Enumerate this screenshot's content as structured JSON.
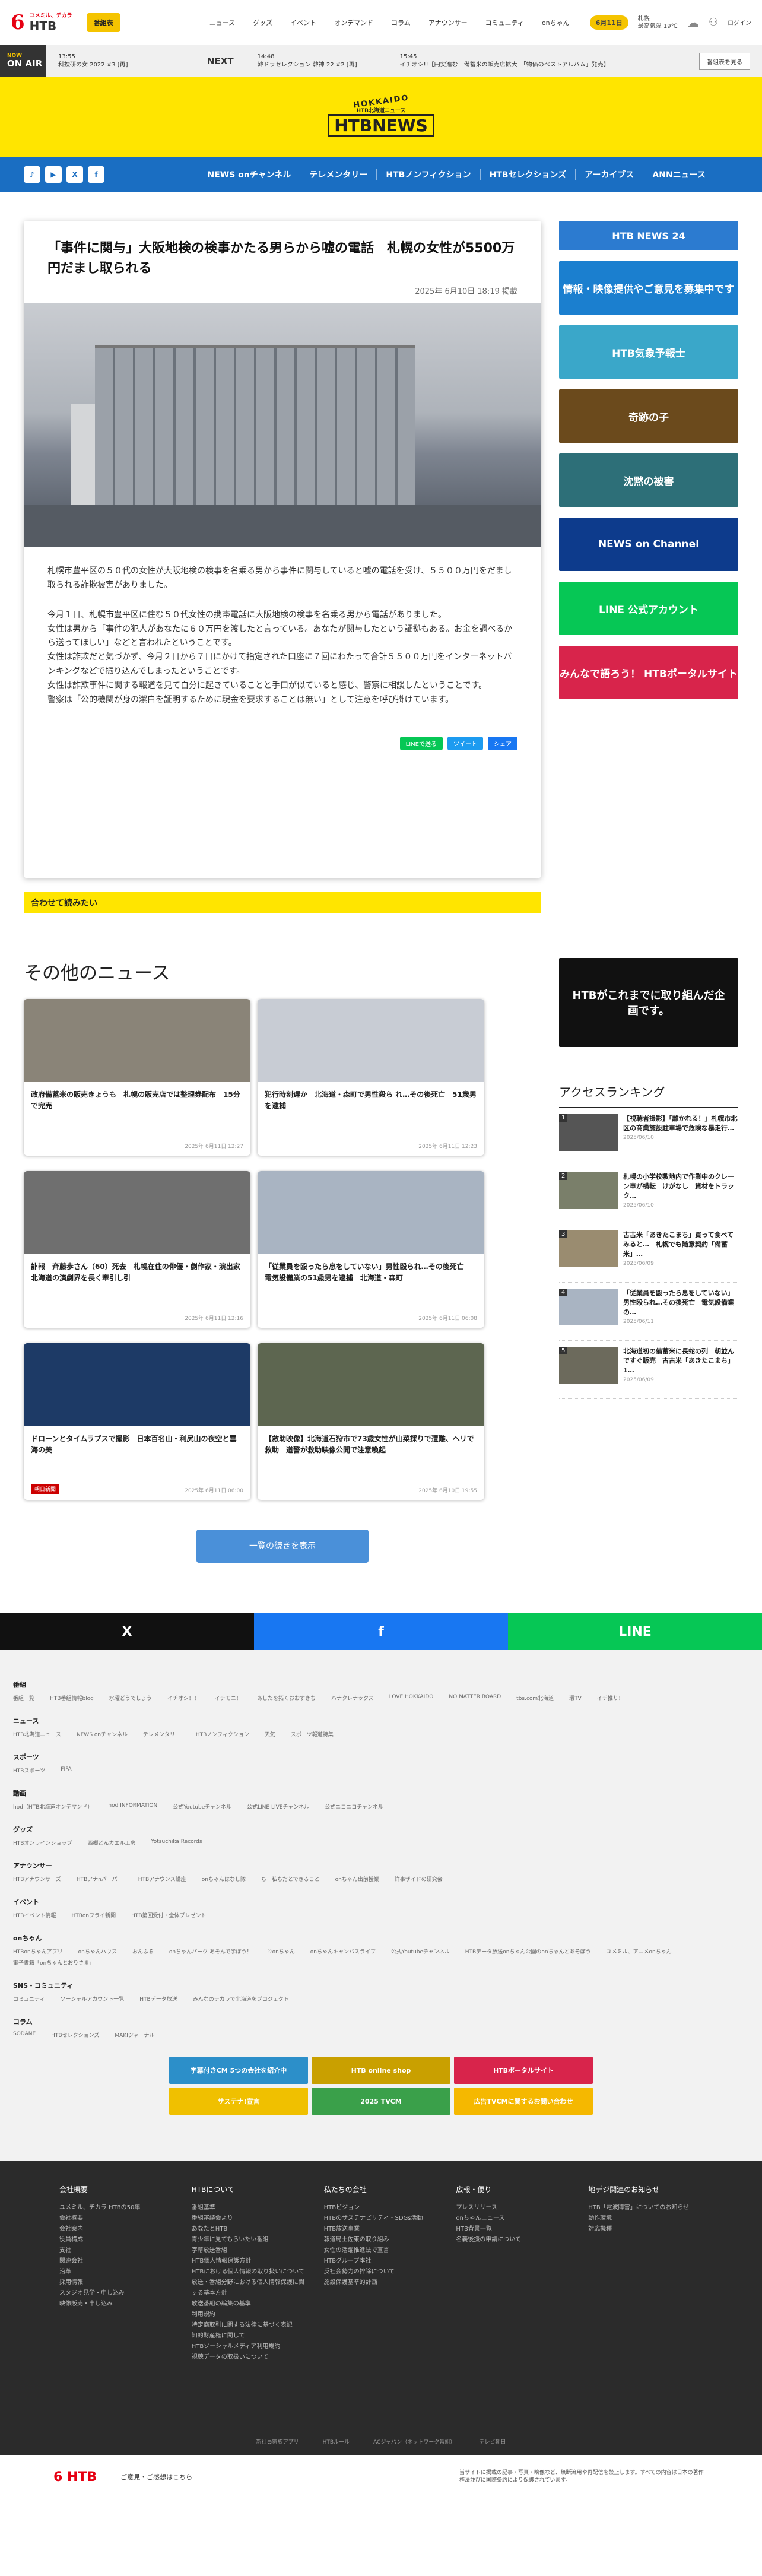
{
  "header": {
    "logo_main": "6",
    "logo_sub": "HTB",
    "logo_tag": "ユメミル、チカラ",
    "bangumi_button": "番組表",
    "nav": [
      "ニュース",
      "グッズ",
      "イベント",
      "オンデマンド",
      "コラム",
      "アナウンサー",
      "コミュニティ",
      "onちゃん"
    ],
    "date": "6月11日",
    "weather": "札幌",
    "weather_temp": "最高気温 19℃",
    "login": "ログイン"
  },
  "onair": {
    "tag_main": "ON AIR",
    "tag_sub": "NOW",
    "now_time": "13:55",
    "now_title": "科捜研の女 2022 #3 [再]",
    "next_label": "NEXT",
    "next_time": "14:48",
    "next_title": "韓ドラセレクション 韓神 22 #2 [再]",
    "ticker_time": "15:45",
    "ticker": "イチオシ!!【円安進む　備蓄米の販売店拡大　「物価のベストアルバム」発売】",
    "button": "番組表を見る"
  },
  "brand": {
    "hokkaido": "HOKKAIDO",
    "name": "HTBNEWS",
    "sub": "HTB北海道ニュース"
  },
  "nav": {
    "social": [
      "TikTok",
      "YouTube",
      "X",
      "Facebook"
    ],
    "links": [
      "NEWS onチャンネル",
      "テレメンタリー",
      "HTBノンフィクション",
      "HTBセレクションズ",
      "アーカイブス",
      "ANNニュース"
    ]
  },
  "article": {
    "title": "「事件に関与」大阪地検の検事かたる男らから嘘の電話　札幌の女性が5500万円だまし取られる",
    "date": "2025年 6月10日 18:19 掲載",
    "lead": "札幌市豊平区の５０代の女性が大阪地検の検事を名乗る男から事件に関与していると嘘の電話を受け、５５００万円をだまし取られる詐欺被害がありました。",
    "paragraphs": [
      "今月１日、札幌市豊平区に住む５０代女性の携帯電話に大阪地検の検事を名乗る男から電話がありました。",
      "女性は男から「事件の犯人があなたに６０万円を渡したと言っている。あなたが関与したという証拠もある。お金を調べるから送ってほしい」などと言われたということです。",
      "女性は詐欺だと気づかず、今月２日から７日にかけて指定された口座に７回にわたって合計５５００万円をインターネットバンキングなどで振り込んでしまったということです。",
      "女性は詐欺事件に関する報道を見て自分に起きていることと手口が似ていると感じ、警察に相談したということです。",
      "警察は「公的機関が身の潔白を証明するために現金を要求することは無い」として注意を呼び掛けています。"
    ],
    "share_line": "LINEで送る",
    "share_x": "ツイート",
    "share_fb": "シェア",
    "cta": "合わせて読みたい"
  },
  "sidebar": {
    "banners": [
      {
        "text": "HTB NEWS 24",
        "color": "#2c7bd0"
      },
      {
        "text": "情報・映像提供やご意見を募集中です",
        "color": "#1b7fcf"
      },
      {
        "text": "HTB気象予報士",
        "color": "#3aa7c9"
      },
      {
        "text": "奇跡の子",
        "color": "#6b4a1c"
      },
      {
        "text": "沈黙の被害",
        "color": "#2d6f78"
      },
      {
        "text": "NEWS on Channel",
        "color": "#0d3b8c"
      },
      {
        "text": "LINE 公式アカウント",
        "color": "#06c755"
      },
      {
        "text": "みんなで語ろう！ HTBポータルサイト",
        "color": "#d8244b"
      }
    ],
    "promo": "HTBがこれまでに取り組んだ企画です。"
  },
  "other": {
    "heading": "その他のニュース",
    "cards": [
      {
        "title": "政府備蓄米の販売きょうも　札幌の販売店では整理券配布　15分で完売",
        "date": "2025年 6月11日 12:27",
        "tag": "",
        "color": "#8a8478"
      },
      {
        "title": "犯行時刻遅か　北海道・森町で男性殺ら れ…その後死亡　51歳男を逮捕",
        "date": "2025年 6月11日 12:23",
        "tag": "",
        "color": "#c8ccd4"
      },
      {
        "title": "訃報　斉藤歩さん（60）死去　札幌在住の俳優・劇作家・演出家　北海道の演劇界を長く牽引し引",
        "date": "2025年 6月11日 12:16",
        "tag": "",
        "color": "#6f6f6f"
      },
      {
        "title": "「従業員を殴ったら息をしていない」男性殴られ…その後死亡　電気設備業の51歳男を逮捕　北海道・森町",
        "date": "2025年 6月11日 06:08",
        "tag": "",
        "color": "#a9b4c2"
      },
      {
        "title": "ドローンとタイムラプスで撮影　日本百名山・利尻山の夜空と雲海の美",
        "date": "2025年 6月11日 06:00",
        "tag": "朝日新聞",
        "color": "#1d3a66"
      },
      {
        "title": "【救助映像】北海道石狩市で73歳女性が山菜採りで遭難、ヘリで救助　道警が救助映像公開で注意喚起",
        "date": "2025年 6月10日 19:55",
        "tag": "",
        "color": "#5d6650"
      }
    ],
    "more_button": "一覧の続きを表示",
    "ranking_title": "アクセスランキング",
    "ranking": [
      {
        "title": "【視聴者撮影】「離かれる！」札幌市北区の商業施設駐車場で危険な暴走行…",
        "date": "2025/06/10",
        "color": "#555"
      },
      {
        "title": "札幌の小学校敷地内で作業中のクレーン車が横転　けがなし　資材をトラック…",
        "date": "2025/06/10",
        "color": "#7a7f6a"
      },
      {
        "title": "古古米「あきたこまち」買って食べてみると…　札幌でも随意契約「備蓄米」…",
        "date": "2025/06/09",
        "color": "#9a8c70"
      },
      {
        "title": "「従業員を殴ったら息をしていない」男性殴られ…その後死亡　電気設備業の…",
        "date": "2025/06/11",
        "color": "#a9b4c2"
      },
      {
        "title": "北海道初の備蓄米に長蛇の列　朝並んですぐ販売　古古米「あきたこまち」1…",
        "date": "2025/06/09",
        "color": "#6c6a5c"
      }
    ]
  },
  "share_row": {
    "x": "X",
    "facebook": "f",
    "line": "LINE"
  },
  "footer_links": [
    {
      "title": "番組",
      "items": [
        "番組一覧",
        "HTB番組情報blog",
        "水曜どうでしょう",
        "イチオシ！！",
        "イチモニ！",
        "あしたを拓くおおすきち",
        "ハナタレナックス",
        "LOVE HOKKAIDO",
        "NO MATTER BOARD",
        "tbs.com北海道",
        "環TV",
        "イチ推り！"
      ]
    },
    {
      "title": "ニュース",
      "items": [
        "HTB北海道ニュース",
        "NEWS onチャンネル",
        "テレメンタリー",
        "HTBノンフィクション",
        "天気",
        "スポーツ報道特集"
      ]
    },
    {
      "title": "スポーツ",
      "items": [
        "HTBスポーツ",
        "FIFA"
      ]
    },
    {
      "title": "動画",
      "items": [
        "hod（HTB北海道オンデマンド）",
        "hod INFORMATION",
        "公式Youtubeチャンネル",
        "公式LINE LIVEチャンネル",
        "公式ニコニコチャンネル"
      ]
    },
    {
      "title": "グッズ",
      "items": [
        "HTBオンラインショップ",
        "西郷どんカエル工房",
        "Yotsuchika Records"
      ]
    },
    {
      "title": "アナウンサー",
      "items": [
        "HTBアナウンサーズ",
        "HTBアナnパーパー",
        "HTBアナウンス講座",
        "onちゃんはなし隊",
        "ち　私ちだとできること",
        "onちゃん出前授業",
        "詳事ザイドの研究会"
      ]
    },
    {
      "title": "イベント",
      "items": [
        "HTBイベント情報",
        "HTBonフライ新聞",
        "HTB第回受付・全体プレゼント"
      ]
    },
    {
      "title": "onちゃん",
      "items": [
        "HTBonちゃんアプリ",
        "onちゃんハウス",
        "おんふる",
        "onちゃんパーク あそんで学ぼう！",
        "♡onちゃん",
        "onちゃんキャンバスライブ",
        "公式Youtubeチャンネル",
        "HTBデータ放送onちゃん公園のonちゃんとあそぼう",
        "ユメミル、アニメonちゃん",
        "電子書籍「onちゃんとおりさま」"
      ]
    },
    {
      "title": "SNS・コミュニティ",
      "items": [
        "コミュニティ",
        "ソーシャルアカウント一覧",
        "HTBデータ放送",
        "みんなのテカラで北海道をプロジェクト"
      ]
    },
    {
      "title": "コラム",
      "items": [
        "SODANE",
        "HTBセレクションズ",
        "MAKIジャーナル"
      ]
    }
  ],
  "footer_banners": [
    {
      "text": "字幕付きCM 5つの会社を紹介中",
      "color": "#2c8fc9"
    },
    {
      "text": "HTB online shop",
      "color": "#c9a000"
    },
    {
      "text": "HTBポータルサイト",
      "color": "#d8244b"
    },
    {
      "text": "サステナ!宣言",
      "color": "#f0c000"
    },
    {
      "text": "2025 TVCM",
      "color": "#3aa04a"
    },
    {
      "text": "広告TVCMに関するお問い合わせ",
      "color": "#f5b800"
    }
  ],
  "footer_cols": [
    {
      "title": "会社概要",
      "items": [
        "ユメミル、チカラ HTBの50年",
        "会社概要",
        "会社案内",
        "役員構成",
        "支社",
        "関連会社",
        "沿革",
        "採用情報",
        "スタジオ見学・申し込み",
        "映像販売・申し込み"
      ]
    },
    {
      "title": "HTBについて",
      "items": [
        "番組基準",
        "番組審議会より",
        "あなたとHTB",
        "青少年に見てもらいたい番組",
        "字幕放送番組",
        "HTB個人情報保護方針",
        "HTBにおける個人情報の取り扱いについて",
        "放送・番組分野における個人情報保護に関する基本方針",
        "放送番組の編集の基準",
        "利用規約",
        "特定商取引に関する法律に基づく表記",
        "知的財産権に関して",
        "HTBソーシャルメディア利用規約",
        "視聴データの取扱いについて"
      ]
    },
    {
      "title": "私たちの会社",
      "items": [
        "HTBビジョン",
        "HTBのサステナビリティ・SDGs活動",
        "HTB放送事業",
        "報道局土佐東の取り組み",
        "女性の活躍推進法で宣言",
        "HTBグループ本社",
        "反社会勢力の排除について",
        "施設保護基準的計画"
      ]
    },
    {
      "title": "広報・便り",
      "items": [
        "プレスリリース",
        "onちゃんニュース",
        "HTB背景一覧",
        "名義後援の申請について"
      ]
    },
    {
      "title": "地デジ関連のお知らせ",
      "items": [
        "HTB「電波障害」についてのお知らせ",
        "動作環境",
        "対応機種"
      ]
    }
  ],
  "footer_bottom_links": [
    "新社員家族アプリ",
    "HTBルール",
    "ACジャパン（ネットワーク番組）",
    "テレビ朝日"
  ],
  "footer_bar": {
    "logo": "6 HTB",
    "contact": "ご意見・ご感想はこちら",
    "copy": "当サイトに掲載の記事・写真・映像など、無断流用や再配信を禁止します。すべての内容は日本の著作権法並びに国際条約により保護されています。"
  }
}
